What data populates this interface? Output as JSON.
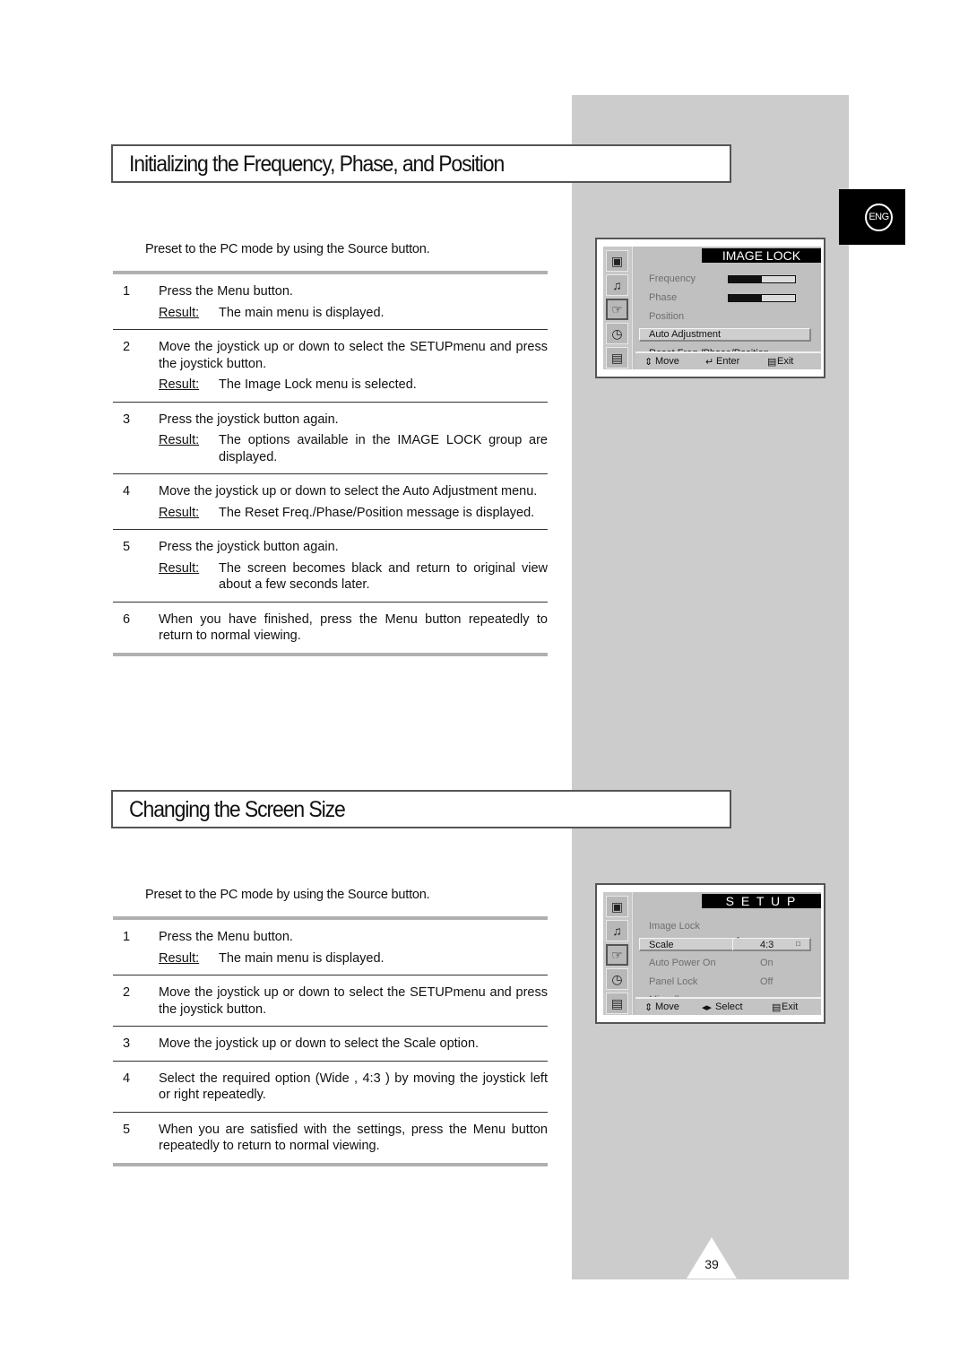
{
  "page": {
    "number": "39",
    "language_badge": "ENG"
  },
  "section1": {
    "title": "Initializing the Frequency, Phase, and Position",
    "intro": "Preset to the PC mode by using the Source  button.",
    "steps": [
      {
        "num": "1",
        "text": "Press the Menu  button.",
        "result_label": "Result:",
        "result": "The main menu is displayed."
      },
      {
        "num": "2",
        "text": "Move the joystick up or down to select the SETUPmenu and press the joystick button.",
        "result_label": "Result:",
        "result": "The Image Lock    menu is selected."
      },
      {
        "num": "3",
        "text": "Press the joystick button again.",
        "result_label": "Result:",
        "result": "The options available in the IMAGE LOCK group are displayed."
      },
      {
        "num": "4",
        "text": "Move the joystick up or down to select the Auto  Adjustment menu.",
        "result_label": "Result:",
        "result": "The Reset Freq./Phase/Position                message is displayed."
      },
      {
        "num": "5",
        "text": "Press the joystick button again.",
        "result_label": "Result:",
        "result": "The screen becomes black and return to original view about a few seconds later."
      },
      {
        "num": "6",
        "text": "When you have finished, press the Menu  button repeatedly to return to normal viewing."
      }
    ],
    "osd": {
      "header": "IMAGE LOCK",
      "items": [
        "Frequency",
        "Phase",
        "Position",
        "Auto Adjustment",
        "Reset Freq./Phase/Position"
      ],
      "frequency_level": 0.5,
      "phase_level": 0.5,
      "selected": "Auto Adjustment",
      "footer": {
        "move": "Move",
        "enter": "Enter",
        "exit": "Exit"
      },
      "icons": [
        "tv-picture-icon",
        "sound-note-icon",
        "setup-hand-icon",
        "clock-icon",
        "tv-input-icon"
      ]
    }
  },
  "section2": {
    "title": "Changing the Screen Size",
    "intro": "Preset to the PC mode by using the Source  button.",
    "steps": [
      {
        "num": "1",
        "text": "Press the Menu  button.",
        "result_label": "Result:",
        "result": "The main menu is displayed."
      },
      {
        "num": "2",
        "text": "Move the joystick up or down to select the SETUPmenu and press the joystick button."
      },
      {
        "num": "3",
        "text": "Move the joystick up or down to select the Scale   option."
      },
      {
        "num": "4",
        "text": "Select the required option (Wide , 4:3  ) by moving the joystick left or right repeatedly."
      },
      {
        "num": "5",
        "text": "When you are satisfied with the settings, press the Menu  button repeatedly to return to normal viewing."
      }
    ],
    "osd": {
      "header": "S E T U P",
      "items": [
        {
          "label": "Image Lock",
          "value": ""
        },
        {
          "label": "Scale",
          "value": "4:3"
        },
        {
          "label": "Auto Power On",
          "value": "On"
        },
        {
          "label": "Panel Lock",
          "value": "Off"
        },
        {
          "label": "Miscellaneous",
          "value": ""
        }
      ],
      "selected": "Scale",
      "footer": {
        "move": "Move",
        "select": "Select",
        "exit": "Exit"
      }
    }
  }
}
